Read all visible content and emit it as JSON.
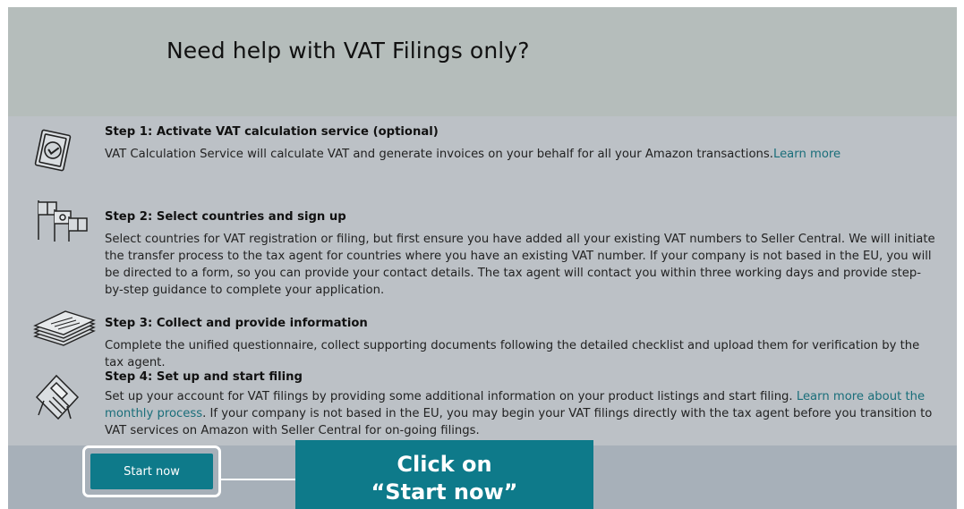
{
  "page": {
    "title": "Need help with VAT Filings only?"
  },
  "steps": [
    {
      "title": "Step 1: Activate VAT calculation service (optional)",
      "body": "VAT Calculation Service will calculate VAT and generate invoices on your behalf for all your Amazon transactions.",
      "link": "Learn more",
      "icon": "certificate-icon"
    },
    {
      "title": "Step 2: Select countries and sign up",
      "body": "Select countries for VAT registration or filing, but first ensure you have added all your existing VAT numbers to Seller Central. We will initiate the transfer process to the tax agent for countries where you have an existing VAT number. If your company is not based in the EU, you will be directed to a form, so you can provide your contact details. The tax agent will contact you within three working days and provide step-by-step guidance to complete your application.",
      "icon": "flags-icon"
    },
    {
      "title": "Step 3: Collect and provide information",
      "body": "Complete the unified questionnaire, collect supporting documents following the detailed checklist and upload them for verification by the tax agent.",
      "icon": "document-stack-icon"
    },
    {
      "title": "Step 4: Set up and start filing",
      "body_before": "Set up your account for VAT filings by providing some additional information on your product listings and start filing.",
      "link": "Learn more about the monthly process",
      "body_after": ". If your company is not based in the EU, you may begin your VAT filings directly with the tax agent before you transition to VAT services on Amazon with Seller Central for on-going filings.",
      "icon": "calendar-filing-icon"
    }
  ],
  "actions": {
    "start_label": "Start now"
  },
  "callout": {
    "line1": "Click on",
    "line2": "“Start now”"
  },
  "colors": {
    "accent": "#0e7a8a",
    "link": "#1a6e7a",
    "header_band": "#b5bdbb",
    "content_band": "#bcc1c6",
    "footer_band": "#a7b0b9"
  }
}
